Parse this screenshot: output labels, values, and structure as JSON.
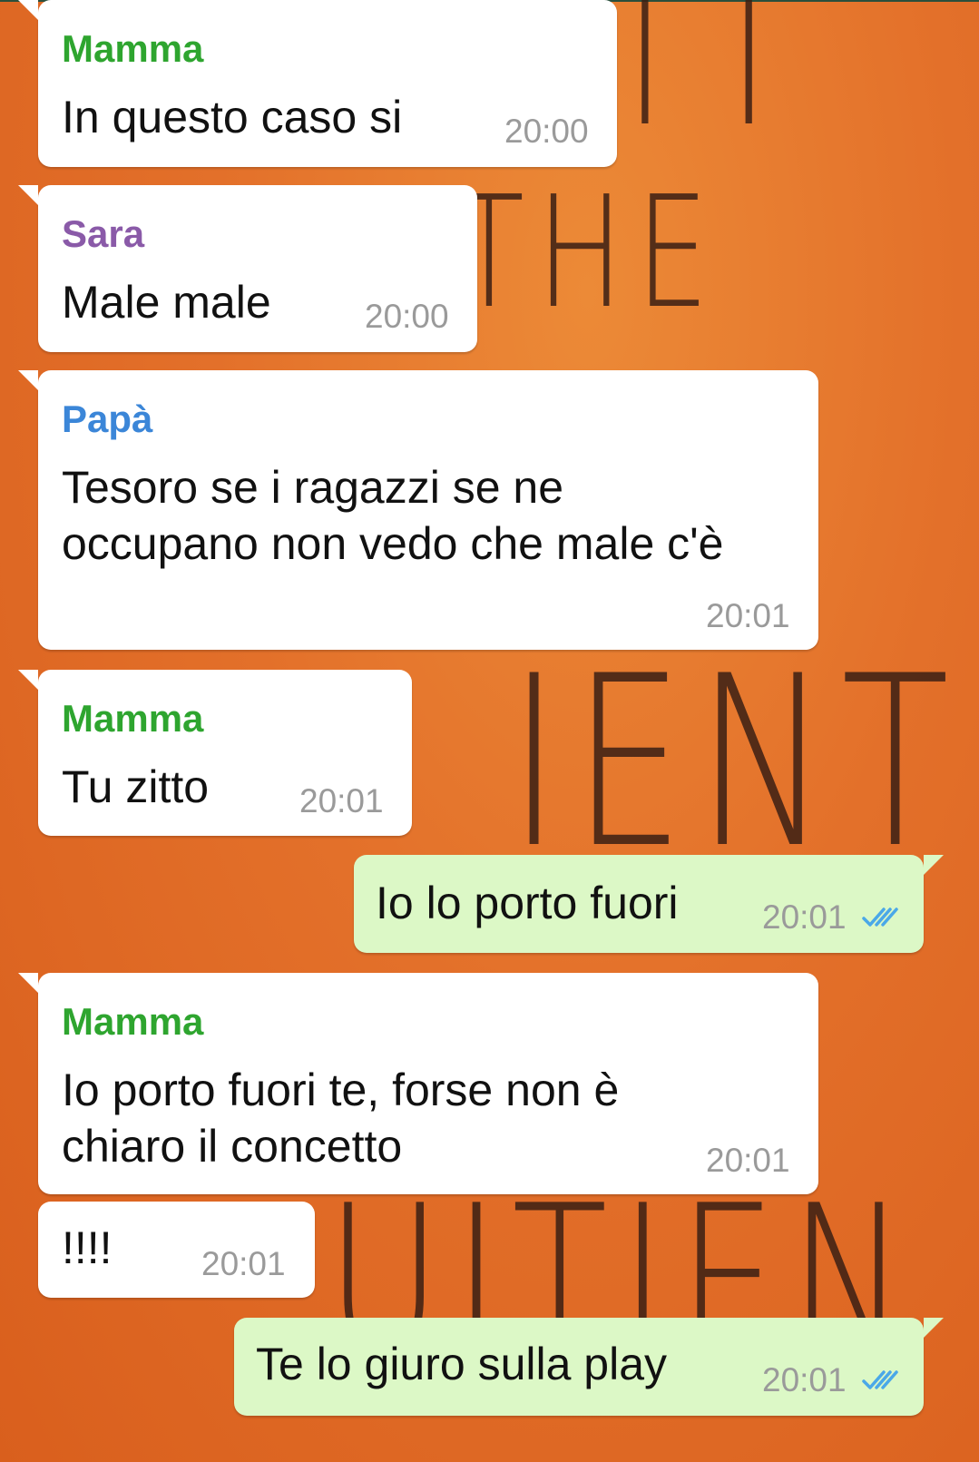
{
  "colors": {
    "mamma": "#2ea52f",
    "sara": "#8a5aa8",
    "papa": "#3b86d8",
    "incoming_bubble": "#ffffff",
    "outgoing_bubble": "#dcf8c6",
    "read_ticks": "#4aa8e8"
  },
  "messages": [
    {
      "sender": "Mamma",
      "lines": [
        "In questo caso si"
      ],
      "time": "20:00"
    },
    {
      "sender": "Sara",
      "lines": [
        "Male male"
      ],
      "time": "20:00"
    },
    {
      "sender": "Papà",
      "lines": [
        "Tesoro se i ragazzi se ne",
        "occupano non vedo che male c'è"
      ],
      "time": "20:01"
    },
    {
      "sender": "Mamma",
      "lines": [
        "Tu zitto"
      ],
      "time": "20:01"
    },
    {
      "lines": [
        "Io lo porto fuori"
      ],
      "time": "20:01",
      "status_icon": "double-check-read-icon"
    },
    {
      "sender": "Mamma",
      "lines": [
        "Io porto fuori te, forse non è",
        "chiaro il concetto"
      ],
      "time": "20:01"
    },
    {
      "lines": [
        "!!!!"
      ],
      "time": "20:01"
    },
    {
      "lines": [
        "Te lo giuro sulla play"
      ],
      "time": "20:01",
      "status_icon": "double-check-read-icon"
    }
  ]
}
